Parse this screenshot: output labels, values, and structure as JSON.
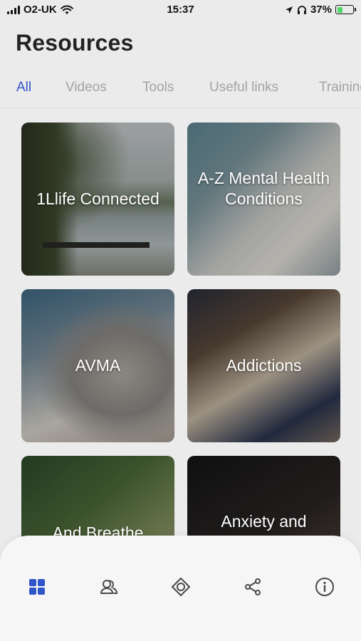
{
  "status_bar": {
    "carrier": "O2-UK",
    "time": "15:37",
    "battery_percent": "37%",
    "battery_level": 0.37
  },
  "header": {
    "title": "Resources"
  },
  "tabs": [
    {
      "label": "All",
      "active": true
    },
    {
      "label": "Videos",
      "active": false
    },
    {
      "label": "Tools",
      "active": false
    },
    {
      "label": "Useful links",
      "active": false
    },
    {
      "label": "Training",
      "active": false
    }
  ],
  "cards": [
    {
      "label": "1Llife Connected"
    },
    {
      "label": "A-Z Mental Health Conditions"
    },
    {
      "label": "AVMA"
    },
    {
      "label": "Addictions"
    },
    {
      "label": "And Breathe"
    },
    {
      "label": "Anxiety and"
    }
  ],
  "bottom_nav": {
    "items": [
      {
        "icon": "dashboard-grid-icon",
        "active": true
      },
      {
        "icon": "people-icon",
        "active": false
      },
      {
        "icon": "diamond-target-icon",
        "active": false
      },
      {
        "icon": "share-icon",
        "active": false
      },
      {
        "icon": "info-icon",
        "active": false
      }
    ]
  },
  "colors": {
    "accent": "#2f55c9",
    "inactive_tab": "#a3a3a3",
    "background": "#ebebeb",
    "nav_icon": "#4a4a4a"
  }
}
